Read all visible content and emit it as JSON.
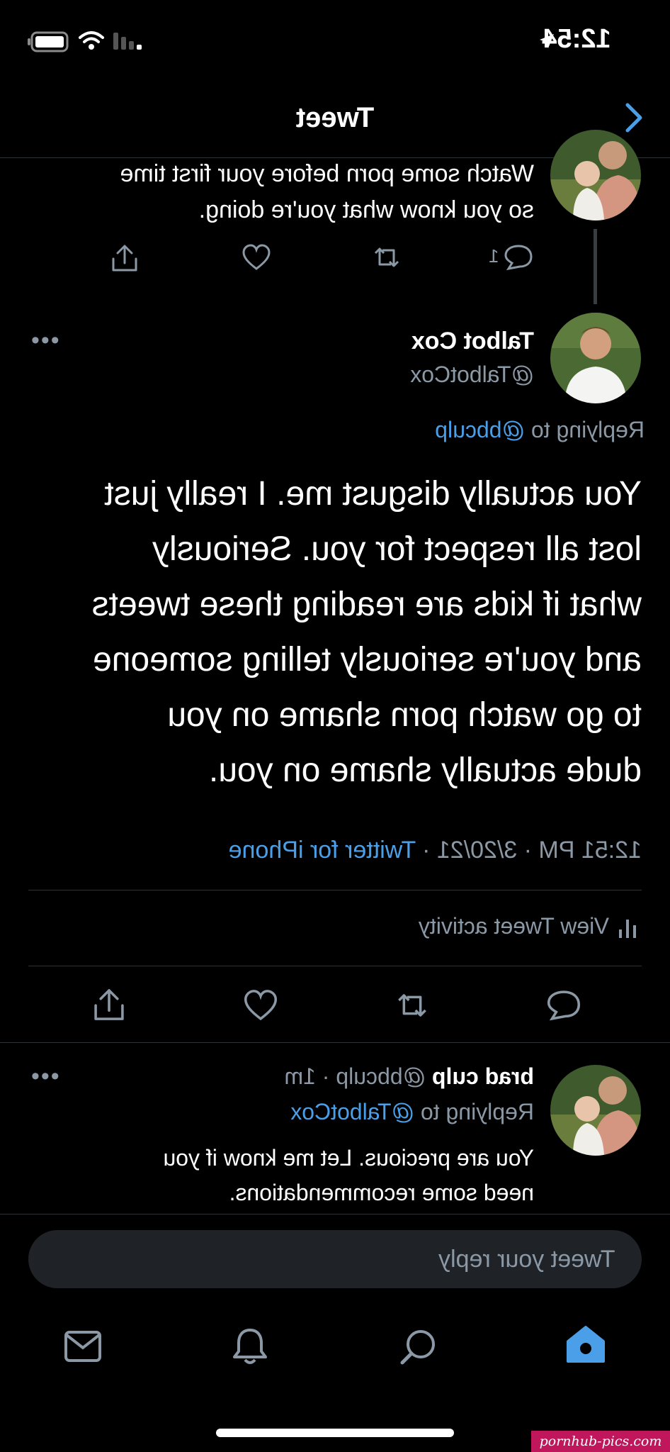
{
  "status_bar": {
    "time": "12:54"
  },
  "header": {
    "title": "Tweet"
  },
  "parent_tweet": {
    "text_line1": "Watch some porn before your first time",
    "text_line2": "so you know what you're doing.",
    "reply_count": "1"
  },
  "main_tweet": {
    "name": "Talbot Cox",
    "handle": "@TalbotCox",
    "replying_prefix": "Replying to",
    "replying_to": "@bbculp",
    "body_lines": [
      "You actually disgust me. I really just",
      "lost all respect for you. Seriously",
      "what if kids are reading these tweets",
      "and you're seriously telling someone",
      "to go watch porn shame on you",
      "dude actually shame on you."
    ],
    "timestamp": "12:51 PM · 3/20/21 ·",
    "source": "Twitter for iPhone",
    "view_activity": "View Tweet activity"
  },
  "reply_tweet": {
    "name": "brad culp",
    "handle_time": "@bbculp · 1m",
    "replying_prefix": "Replying to",
    "replying_to": "@TalbotCox",
    "text_line1": "You are precious. Let me know if you",
    "text_line2": "need some recommendations."
  },
  "compose": {
    "placeholder": "Tweet your reply"
  },
  "tab_bar": {
    "tabs": [
      "home",
      "search",
      "notifications",
      "messages"
    ]
  },
  "watermark": "pornhub-pics.com",
  "colors": {
    "accent": "#4a9fe8",
    "background": "#000000",
    "muted": "#8b98a5",
    "divider": "#2f3336"
  }
}
